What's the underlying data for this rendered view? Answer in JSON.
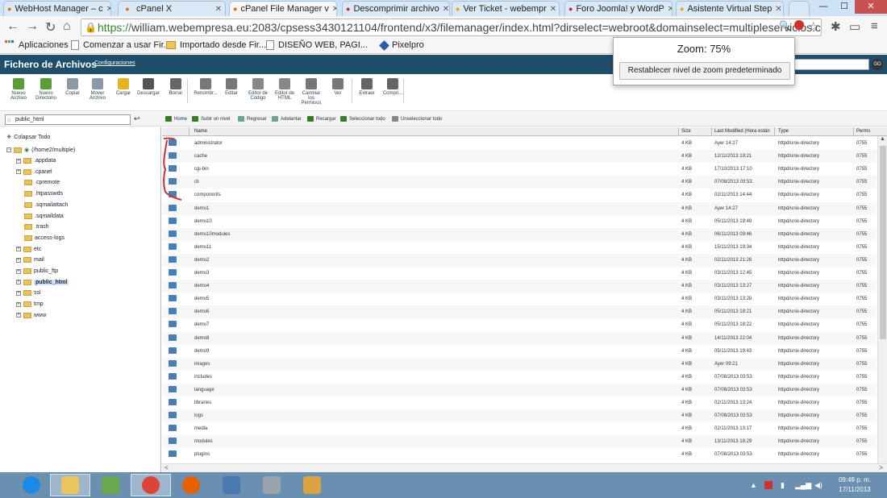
{
  "browser": {
    "tabs": [
      {
        "label": "WebHost Manager – c",
        "icon": "cpanel-icon",
        "color": "#e86d00"
      },
      {
        "label": "cPanel X",
        "icon": "cpanel-icon",
        "color": "#e86d00"
      },
      {
        "label": "cPanel File Manager v",
        "icon": "cpanel-icon",
        "color": "#e86d00",
        "active": true
      },
      {
        "label": "Descomprimir archivo",
        "icon": "webempresa-icon",
        "color": "#c62828"
      },
      {
        "label": "Ver Ticket - webempr",
        "icon": "ticket-icon",
        "color": "#e8a400"
      },
      {
        "label": "Foro Joomla! y WordP",
        "icon": "webempresa-icon",
        "color": "#c62828"
      },
      {
        "label": "Asistente Virtual Step",
        "icon": "ticket-icon",
        "color": "#e8a400"
      }
    ],
    "url_scheme": "https://",
    "url_rest": "william.webempresa.eu:2083/cpsess3430121104/frontend/x3/filemanager/index.html?dirselect=webroot&domainselect=multipleservicios.com",
    "bookmarks": [
      {
        "label": "Aplicaciones",
        "icon": "apps-icon"
      },
      {
        "label": "Comenzar a usar Fir...",
        "icon": "page-icon"
      },
      {
        "label": "Importado desde Fir...",
        "icon": "folder-icon"
      },
      {
        "label": "DISEÑO WEB, PAGI...",
        "icon": "page-icon"
      },
      {
        "label": "Pixelpro",
        "icon": "pixelpro-icon"
      }
    ],
    "zoom_popup": {
      "label": "Zoom: 75%",
      "button": "Restablecer nivel de zoom predeterminado"
    }
  },
  "header": {
    "title": "Fichero de Archivos",
    "config_link": "Configuraciones"
  },
  "toolbar": [
    {
      "label": "Nuevo Archivo",
      "icon": "new-file-icon",
      "color": "#5a9e3a"
    },
    {
      "label": "Nuevo Directorio",
      "icon": "new-folder-icon",
      "color": "#5a9e3a"
    },
    {
      "label": "Copiar",
      "icon": "copy-icon",
      "color": "#8a9aa8"
    },
    {
      "label": "Mover Archivo",
      "icon": "move-icon",
      "color": "#8a9aa8"
    },
    {
      "label": "Cargar",
      "icon": "upload-icon",
      "color": "#e6b422"
    },
    {
      "label": "Descargar",
      "icon": "download-icon",
      "color": "#555555"
    },
    {
      "label": "Borrar",
      "icon": "delete-icon",
      "color": "#666666"
    },
    {
      "label": "Renombr...",
      "icon": "rename-icon",
      "color": "#777777"
    },
    {
      "label": "Editar",
      "icon": "edit-icon",
      "color": "#777777"
    },
    {
      "label": "Editor de Código",
      "icon": "code-editor-icon",
      "color": "#888888"
    },
    {
      "label": "Editor de HTML",
      "icon": "html-editor-icon",
      "color": "#888888"
    },
    {
      "label": "Cambiar los Permisos",
      "icon": "permissions-icon",
      "color": "#777777"
    },
    {
      "label": "Ver",
      "icon": "view-icon",
      "color": "#777777"
    },
    {
      "label": "Extraer",
      "icon": "extract-icon",
      "color": "#666666"
    },
    {
      "label": "Compri...",
      "icon": "compress-icon",
      "color": "#666666"
    }
  ],
  "pathbar": {
    "path_value": "public_html",
    "buttons": [
      {
        "label": "Home",
        "icon": "home-icon",
        "color": "#3a7a2a"
      },
      {
        "label": "Subir un nivel",
        "icon": "up-level-icon",
        "color": "#3a7a2a"
      },
      {
        "label": "Regresar",
        "icon": "back-icon",
        "color": "#6a8"
      },
      {
        "label": "Adelantar",
        "icon": "forward-icon",
        "color": "#6a8"
      },
      {
        "label": "Recargar",
        "icon": "reload-icon",
        "color": "#3a7a2a"
      },
      {
        "label": "Seleccionar todo",
        "icon": "select-all-icon",
        "color": "#3a7a2a"
      },
      {
        "label": "Unseleccionar todo",
        "icon": "unselect-all-icon",
        "color": "#888"
      }
    ]
  },
  "tree": {
    "collapse_label": "Colapsar Todo",
    "root": "(/home2/multiple)",
    "items": [
      {
        "label": ".appdata",
        "expandable": true
      },
      {
        "label": ".cpanel",
        "expandable": true
      },
      {
        "label": ".cpremote",
        "expandable": false
      },
      {
        "label": ".htpasswds",
        "expandable": false
      },
      {
        "label": ".sqmailattach",
        "expandable": false
      },
      {
        "label": ".sqmaildata",
        "expandable": false
      },
      {
        "label": ".trash",
        "expandable": false
      },
      {
        "label": "access-logs",
        "expandable": false
      },
      {
        "label": "etc",
        "expandable": true
      },
      {
        "label": "mail",
        "expandable": true
      },
      {
        "label": "public_ftp",
        "expandable": true
      },
      {
        "label": "public_html",
        "expandable": true,
        "selected": true
      },
      {
        "label": "ssl",
        "expandable": true
      },
      {
        "label": "tmp",
        "expandable": true
      },
      {
        "label": "www",
        "expandable": true
      }
    ]
  },
  "table": {
    "columns": [
      "Name",
      "Size",
      "Last Modified (Hora están",
      "Type",
      "Perms"
    ],
    "rows": [
      {
        "name": "administrator",
        "size": "4 KB",
        "modified": "Ayer 14:27",
        "type": "httpd/unix-directory",
        "perms": "0755"
      },
      {
        "name": "cache",
        "size": "4 KB",
        "modified": "12/11/2013 19:21",
        "type": "httpd/unix-directory",
        "perms": "0755"
      },
      {
        "name": "cgi-bin",
        "size": "4 KB",
        "modified": "17/10/2013 17:10",
        "type": "httpd/unix-directory",
        "perms": "0755"
      },
      {
        "name": "cli",
        "size": "4 KB",
        "modified": "07/08/2013 03:53",
        "type": "httpd/unix-directory",
        "perms": "0755"
      },
      {
        "name": "components",
        "size": "4 KB",
        "modified": "02/11/2013 14:44",
        "type": "httpd/unix-directory",
        "perms": "0755"
      },
      {
        "name": "demo1",
        "size": "4 KB",
        "modified": "Ayer 14:27",
        "type": "httpd/unix-directory",
        "perms": "0755"
      },
      {
        "name": "demo10",
        "size": "4 KB",
        "modified": "05/11/2013 19:49",
        "type": "httpd/unix-directory",
        "perms": "0755"
      },
      {
        "name": "demo10modules",
        "size": "4 KB",
        "modified": "06/11/2013 09:46",
        "type": "httpd/unix-directory",
        "perms": "0755"
      },
      {
        "name": "demo11",
        "size": "4 KB",
        "modified": "15/11/2013 19:34",
        "type": "httpd/unix-directory",
        "perms": "0755"
      },
      {
        "name": "demo2",
        "size": "4 KB",
        "modified": "02/11/2013 21:26",
        "type": "httpd/unix-directory",
        "perms": "0755"
      },
      {
        "name": "demo3",
        "size": "4 KB",
        "modified": "03/11/2013 12:45",
        "type": "httpd/unix-directory",
        "perms": "0755"
      },
      {
        "name": "demo4",
        "size": "4 KB",
        "modified": "03/11/2013 13:27",
        "type": "httpd/unix-directory",
        "perms": "0755"
      },
      {
        "name": "demo5",
        "size": "4 KB",
        "modified": "03/11/2013 13:28",
        "type": "httpd/unix-directory",
        "perms": "0755"
      },
      {
        "name": "demo6",
        "size": "4 KB",
        "modified": "05/11/2013 18:21",
        "type": "httpd/unix-directory",
        "perms": "0755"
      },
      {
        "name": "demo7",
        "size": "4 KB",
        "modified": "05/11/2013 18:22",
        "type": "httpd/unix-directory",
        "perms": "0755"
      },
      {
        "name": "demo8",
        "size": "4 KB",
        "modified": "14/11/2013 22:04",
        "type": "httpd/unix-directory",
        "perms": "0755"
      },
      {
        "name": "demo9",
        "size": "4 KB",
        "modified": "05/11/2013 19:43",
        "type": "httpd/unix-directory",
        "perms": "0755"
      },
      {
        "name": "images",
        "size": "4 KB",
        "modified": "Ayer 09:21",
        "type": "httpd/unix-directory",
        "perms": "0755"
      },
      {
        "name": "includes",
        "size": "4 KB",
        "modified": "07/08/2013 03:53",
        "type": "httpd/unix-directory",
        "perms": "0755"
      },
      {
        "name": "language",
        "size": "4 KB",
        "modified": "07/08/2013 03:53",
        "type": "httpd/unix-directory",
        "perms": "0755"
      },
      {
        "name": "libraries",
        "size": "4 KB",
        "modified": "02/11/2013 13:24",
        "type": "httpd/unix-directory",
        "perms": "0755"
      },
      {
        "name": "logs",
        "size": "4 KB",
        "modified": "07/08/2013 03:53",
        "type": "httpd/unix-directory",
        "perms": "0755"
      },
      {
        "name": "media",
        "size": "4 KB",
        "modified": "02/11/2013 13:17",
        "type": "httpd/unix-directory",
        "perms": "0755"
      },
      {
        "name": "modules",
        "size": "4 KB",
        "modified": "13/11/2013 18:29",
        "type": "httpd/unix-directory",
        "perms": "0755"
      },
      {
        "name": "plugins",
        "size": "4 KB",
        "modified": "07/08/2013 03:53",
        "type": "httpd/unix-directory",
        "perms": "0755"
      }
    ]
  },
  "taskbar": {
    "apps": [
      {
        "icon": "internet-explorer-icon",
        "color": "#1e88e5"
      },
      {
        "icon": "file-explorer-icon",
        "color": "#e8c45a",
        "active": true
      },
      {
        "icon": "webmatrix-icon",
        "color": "#6aa84f"
      },
      {
        "icon": "chrome-icon",
        "color": "#db4437",
        "active": true
      },
      {
        "icon": "firefox-icon",
        "color": "#e66000"
      },
      {
        "icon": "remote-desktop-icon",
        "color": "#4a78b0"
      },
      {
        "icon": "calculator-icon",
        "color": "#9aa4ae"
      },
      {
        "icon": "paint-icon",
        "color": "#d9a441"
      }
    ],
    "time": "09:49 p. m.",
    "date": "17/11/2013"
  },
  "colors": {
    "header_bg": "#1f4d6c",
    "folder_icon": "#4a7fb5",
    "annotation": "#d32f2f",
    "taskbar_bg": "#6a8fb0"
  }
}
